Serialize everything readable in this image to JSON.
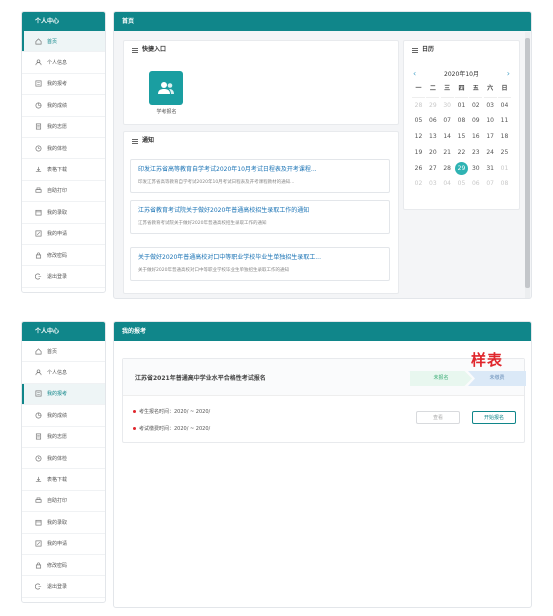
{
  "top": {
    "sidebar": {
      "title": "个人中心",
      "items": [
        {
          "label": "首页",
          "icon": "home-icon"
        },
        {
          "label": "个人信息",
          "icon": "user-icon"
        },
        {
          "label": "我的报考",
          "icon": "list-icon"
        },
        {
          "label": "我的成绩",
          "icon": "chart-icon"
        },
        {
          "label": "我的志愿",
          "icon": "doc-icon"
        },
        {
          "label": "我的体检",
          "icon": "clock-icon"
        },
        {
          "label": "表格下载",
          "icon": "download-icon"
        },
        {
          "label": "自助打印",
          "icon": "print-icon"
        },
        {
          "label": "我的录取",
          "icon": "calendar-icon"
        },
        {
          "label": "我的申请",
          "icon": "edit-icon"
        },
        {
          "label": "修改密码",
          "icon": "lock-icon"
        },
        {
          "label": "退出登录",
          "icon": "logout-icon"
        }
      ],
      "active_index": 0
    },
    "page_title": "首页",
    "quick": {
      "title": "快捷入口",
      "tile_label": "学考报名"
    },
    "notices": {
      "title": "通知",
      "items": [
        {
          "title": "印发江苏省高等教育自学考试2020年10月考试日程表及开考课程...",
          "desc": "印发江苏省高等教育自学考试2020年10月考试日程表及开考课程教材的通知..."
        },
        {
          "title": "江苏省教育考试院关于做好2020年普通高校招生录取工作的通知",
          "desc": "江苏省教育考试院关于做好2020年普通高校招生录取工作的通知"
        },
        {
          "title": "关于做好2020年普通高校对口中等职业学校毕业生单独招生录取工...",
          "desc": "关于做好2020年普通高校对口中等职业学校毕业生单独招生录取工作的通知"
        }
      ]
    },
    "calendar": {
      "title": "日历",
      "month_label": "2020年10月",
      "weekdays": [
        "一",
        "二",
        "三",
        "四",
        "五",
        "六",
        "日"
      ],
      "weeks": [
        [
          "28",
          "29",
          "30",
          "01",
          "02",
          "03",
          "04"
        ],
        [
          "05",
          "06",
          "07",
          "08",
          "09",
          "10",
          "11"
        ],
        [
          "12",
          "13",
          "14",
          "15",
          "16",
          "17",
          "18"
        ],
        [
          "19",
          "20",
          "21",
          "22",
          "23",
          "24",
          "25"
        ],
        [
          "26",
          "27",
          "28",
          "29",
          "30",
          "31",
          "01"
        ],
        [
          "02",
          "03",
          "04",
          "05",
          "06",
          "07",
          "08"
        ]
      ],
      "today": "29"
    }
  },
  "bottom": {
    "sidebar": {
      "title": "个人中心",
      "items": [
        {
          "label": "首页",
          "icon": "home-icon"
        },
        {
          "label": "个人信息",
          "icon": "user-icon"
        },
        {
          "label": "我的报考",
          "icon": "list-icon"
        },
        {
          "label": "我的成绩",
          "icon": "chart-icon"
        },
        {
          "label": "我的志愿",
          "icon": "doc-icon"
        },
        {
          "label": "我的体检",
          "icon": "clock-icon"
        },
        {
          "label": "表格下载",
          "icon": "download-icon"
        },
        {
          "label": "自助打印",
          "icon": "print-icon"
        },
        {
          "label": "我的录取",
          "icon": "calendar-icon"
        },
        {
          "label": "我的申请",
          "icon": "edit-icon"
        },
        {
          "label": "修改密码",
          "icon": "lock-icon"
        },
        {
          "label": "退出登录",
          "icon": "logout-icon"
        }
      ],
      "active_index": 2
    },
    "page_title": "我的报考",
    "exam": {
      "title": "江苏省2021年普通高中学业水平合格性考试报名",
      "stamp": "样表",
      "step1": "未报名",
      "step2": "未缴费",
      "reg_time": "考生报名时间：2020/          ~ 2020/",
      "fix_time": "考试缴费时间：2020/          ~ 2020/",
      "btn_view": "查看",
      "btn_start": "开始报名"
    }
  },
  "colors": {
    "accent": "#10868a",
    "link": "#1a73b5",
    "stamp": "#e0262c",
    "today": "#2fb3b3"
  }
}
